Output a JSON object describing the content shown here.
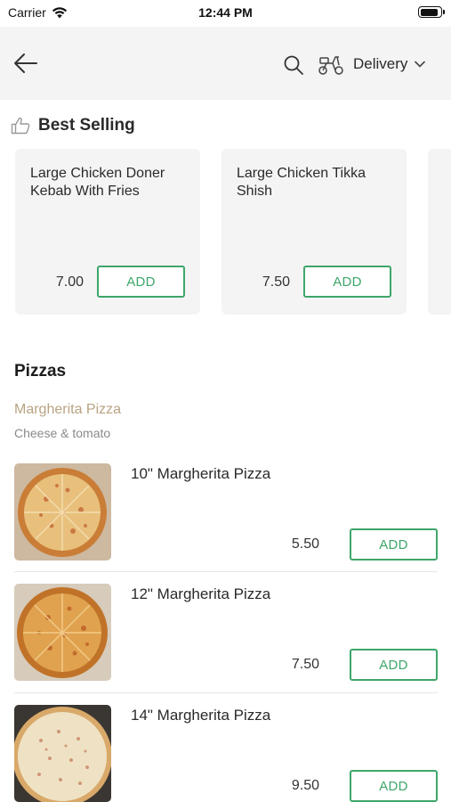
{
  "status_bar": {
    "carrier": "Carrier",
    "time": "12:44 PM",
    "battery_level": 0.95
  },
  "header": {
    "mode_label": "Delivery"
  },
  "best_selling": {
    "title": "Best Selling",
    "items": [
      {
        "name": "Large Chicken Doner Kebab With Fries",
        "price": "7.00",
        "add_label": "ADD"
      },
      {
        "name": "Large Chicken Tikka Shish",
        "price": "7.50",
        "add_label": "ADD"
      }
    ]
  },
  "category": {
    "title": "Pizzas",
    "subcategory": "Margherita Pizza",
    "description": "Cheese & tomato",
    "items": [
      {
        "name": "10\" Margherita Pizza",
        "price": "5.50",
        "add_label": "ADD"
      },
      {
        "name": "12\" Margherita Pizza",
        "price": "7.50",
        "add_label": "ADD"
      },
      {
        "name": "14\" Margherita Pizza",
        "price": "9.50",
        "add_label": "ADD"
      }
    ]
  },
  "colors": {
    "accent": "#3ea66a",
    "subcategory": "#b9a383",
    "header_bg": "#f4f4f4",
    "card_bg": "#f4f4f4"
  }
}
